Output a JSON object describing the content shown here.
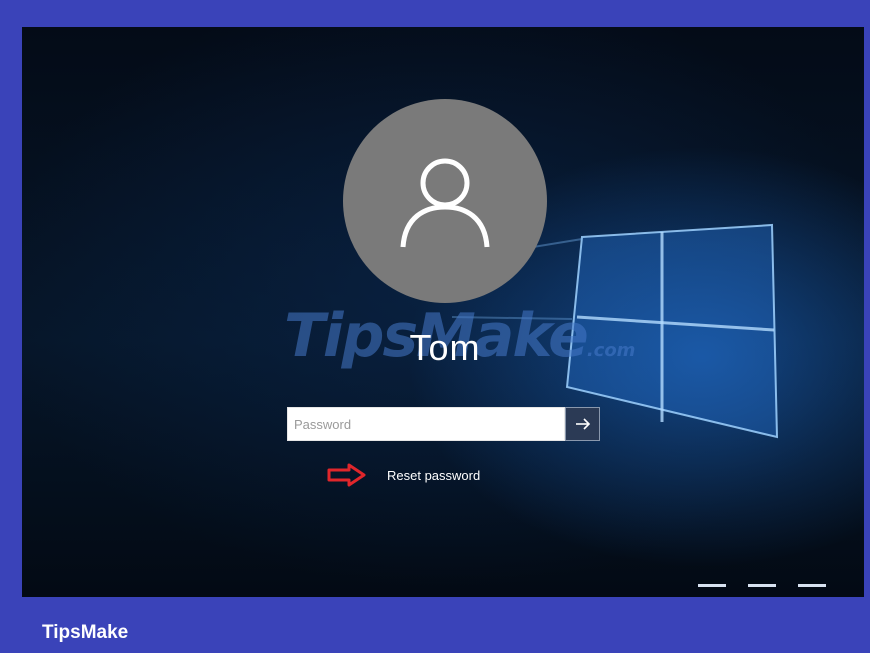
{
  "lock_screen": {
    "user_name": "Tom",
    "password_placeholder": "Password",
    "submit_icon": "arrow-right-icon",
    "reset_password_label": "Reset password",
    "annotation_icon": "red-outline-arrow-icon",
    "avatar_icon": "user-icon"
  },
  "watermark": {
    "text": "TipsMake",
    "suffix": ".com"
  },
  "footer": {
    "brand": "TipsMake"
  },
  "colors": {
    "frame_border": "#3a43b9",
    "avatar_bg": "#7a7a7a",
    "annotation_red": "#e0262b",
    "submit_bg": "#2b3a55"
  }
}
